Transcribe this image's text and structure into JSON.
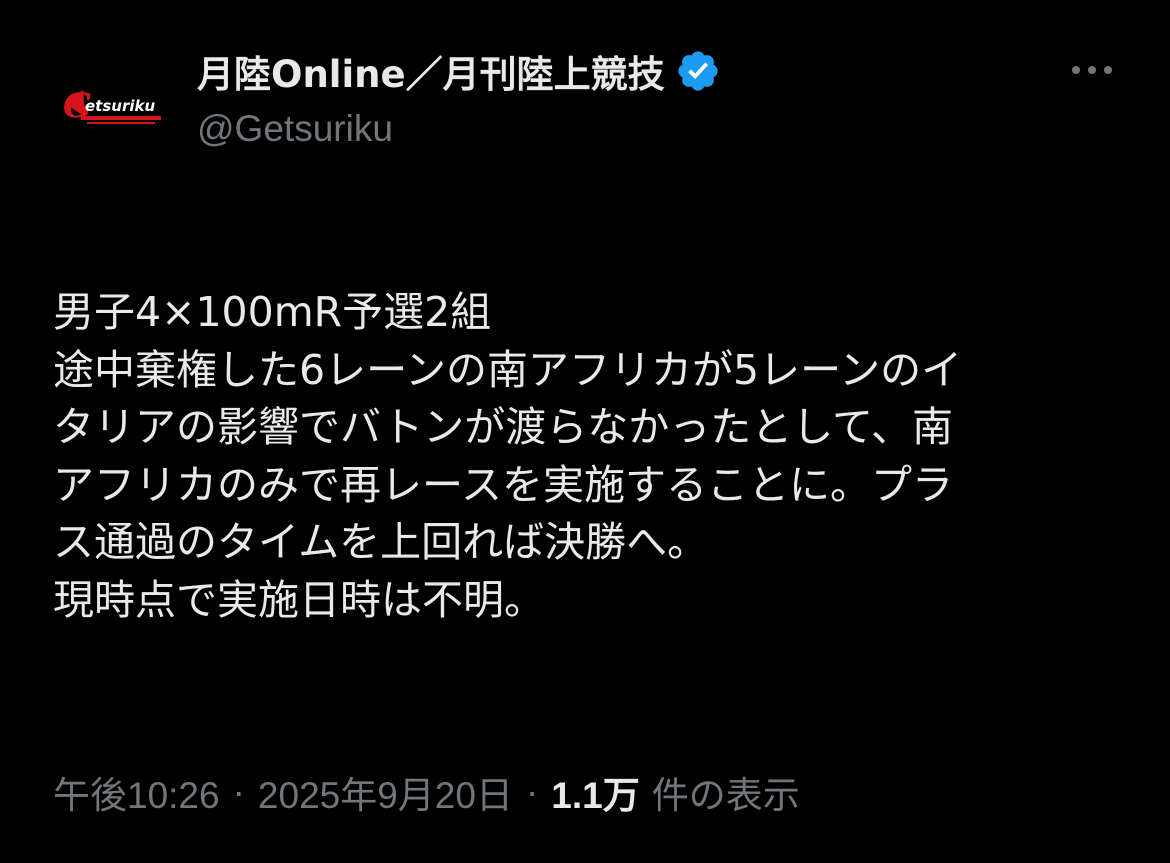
{
  "author": {
    "display_name": "月陸Online／月刊陸上競技",
    "handle": "@Getsuriku",
    "avatar_text": "Getsuriku",
    "verified": true,
    "verified_color": "#1d9bf0",
    "avatar_color": "#d7141a"
  },
  "more_icon": "more-horizontal-icon",
  "tweet": {
    "lines": [
      "男子4×100mR予選2組",
      "途中棄権した6レーンの南アフリカが5レーンのイ",
      "タリアの影響でバトンが渡らなかったとして、南",
      "アフリカのみで再レースを実施することに。プラ",
      "ス通過のタイムを上回れば決勝へ。",
      "現時点で実施日時は不明。"
    ]
  },
  "meta": {
    "time": "午後10:26",
    "separator": "·",
    "date": "2025年9月20日",
    "views_count": "1.1万",
    "views_label": "件の表示"
  }
}
